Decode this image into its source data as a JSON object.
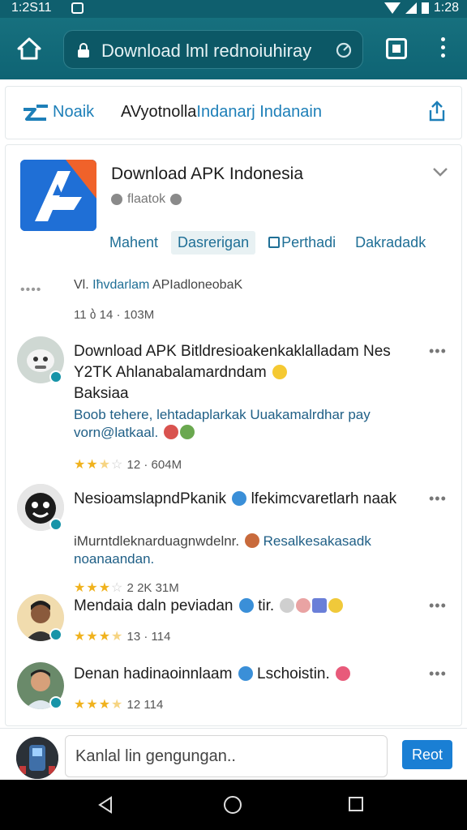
{
  "status_bar": {
    "time_left": "1:2S11",
    "time_right": "1:28"
  },
  "browser": {
    "url_text": "Download lml rednoiuhiray",
    "icons": [
      "home-icon",
      "lock-icon",
      "refresh-icon",
      "tabs-icon",
      "menu-icon"
    ]
  },
  "site": {
    "name": "Noaik",
    "tagline_part1": "AVyotnolla",
    "tagline_part2": "Indanarj Indanain"
  },
  "app": {
    "title": "Download APK Indonesia",
    "subtitle": "flaatok",
    "tabs": [
      {
        "label": "Mahent"
      },
      {
        "label": "Dasrerigan"
      },
      {
        "label": "Perthadi"
      },
      {
        "label": "Dakradadk"
      }
    ]
  },
  "summary": {
    "dots": "••••",
    "prefix": "Vl.",
    "highlight": "Iħvdarlam",
    "rest": "APIadloneobaK",
    "meta": "11 ბ 14 · 103M"
  },
  "comments": [
    {
      "title": "Download APK Bitldresioakenkaklalladam Nes Y2TK Ahlanabalamardndam",
      "title_line3": "Baksiaa",
      "body": "Boob tehere, lehtadaplarkak Uuakamalrdhar pay vorn@latkaal.",
      "rating": 2.5,
      "meta": "12 · 604M"
    },
    {
      "title": "NesioamslapndPkanik",
      "title_extra": "lfekimcvaretlarh naak",
      "body_gray": "iMurntdleknarduagnwdelnr.",
      "body_blue": "Resalkesakasadk noanaandan.",
      "rating": 3,
      "meta": "2K 31M",
      "meta_lead": "2"
    },
    {
      "title": "Mendaia daln peviadan",
      "title_extra": "tir.",
      "rating": 3.5,
      "meta": "13 · 114"
    },
    {
      "title": "Denan hadinaoinnlaam",
      "title_extra": "Lschoistin.",
      "rating": 3.5,
      "meta": "12 114"
    }
  ],
  "composer": {
    "placeholder": "Kanlal lin gengungan..",
    "post_label": "Reot"
  },
  "colors": {
    "accent": "#1d7fb8",
    "toolbar": "#0e6474",
    "star": "#f0b21d",
    "button": "#1a7fd4"
  }
}
